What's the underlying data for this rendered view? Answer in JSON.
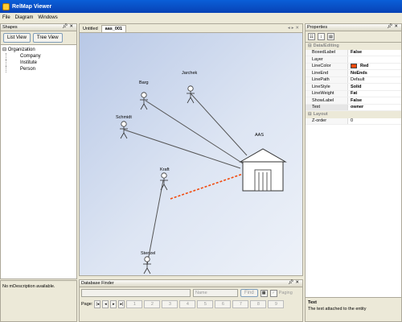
{
  "window": {
    "title": "RelMap Viewer"
  },
  "menu": [
    "File",
    "Diagram",
    "Windows"
  ],
  "shapes_panel": {
    "title": "Shapes",
    "list_view": "List View",
    "tree_view": "Tree View",
    "tree_root": "Organization",
    "tree_children": [
      "Company",
      "Institute",
      "Person"
    ],
    "description": "No mDescription available."
  },
  "tabs": {
    "untitled": "Untitled",
    "active": "aas_001"
  },
  "diagram": {
    "building_label": "AAS",
    "people": [
      "Barg",
      "Jarchek",
      "Schmidt",
      "Kraft",
      "Stenzel"
    ],
    "colors": {
      "link": "#555555",
      "highlight": "#f14a0d"
    }
  },
  "db_finder": {
    "title": "Database Finder",
    "name_placeholder": "Name",
    "find_button": "Find",
    "paging_label": "Paging",
    "page_label": "Page:",
    "pages": [
      "1",
      "2",
      "3",
      "4",
      "5",
      "6",
      "7",
      "8",
      "9"
    ]
  },
  "properties": {
    "title": "Properties",
    "category_1": "Data/Editing",
    "rows": [
      {
        "key": "BoxedLabel",
        "value": "False"
      },
      {
        "key": "Layer",
        "value": ""
      },
      {
        "key": "LineColor",
        "value": "Red",
        "color": "#f14a0d"
      },
      {
        "key": "LineEnd",
        "value": "NoEnds"
      },
      {
        "key": "LinePath",
        "value": "Default"
      },
      {
        "key": "LineStyle",
        "value": "Solid"
      },
      {
        "key": "LineWeight",
        "value": "Fat"
      },
      {
        "key": "ShowLabel",
        "value": "False"
      },
      {
        "key": "Text",
        "value": "owner"
      }
    ],
    "category_2": "Layout",
    "rows2": [
      {
        "key": "Z-order",
        "value": "0"
      }
    ],
    "help_title": "Text",
    "help_text": "The text attached to the entity"
  }
}
